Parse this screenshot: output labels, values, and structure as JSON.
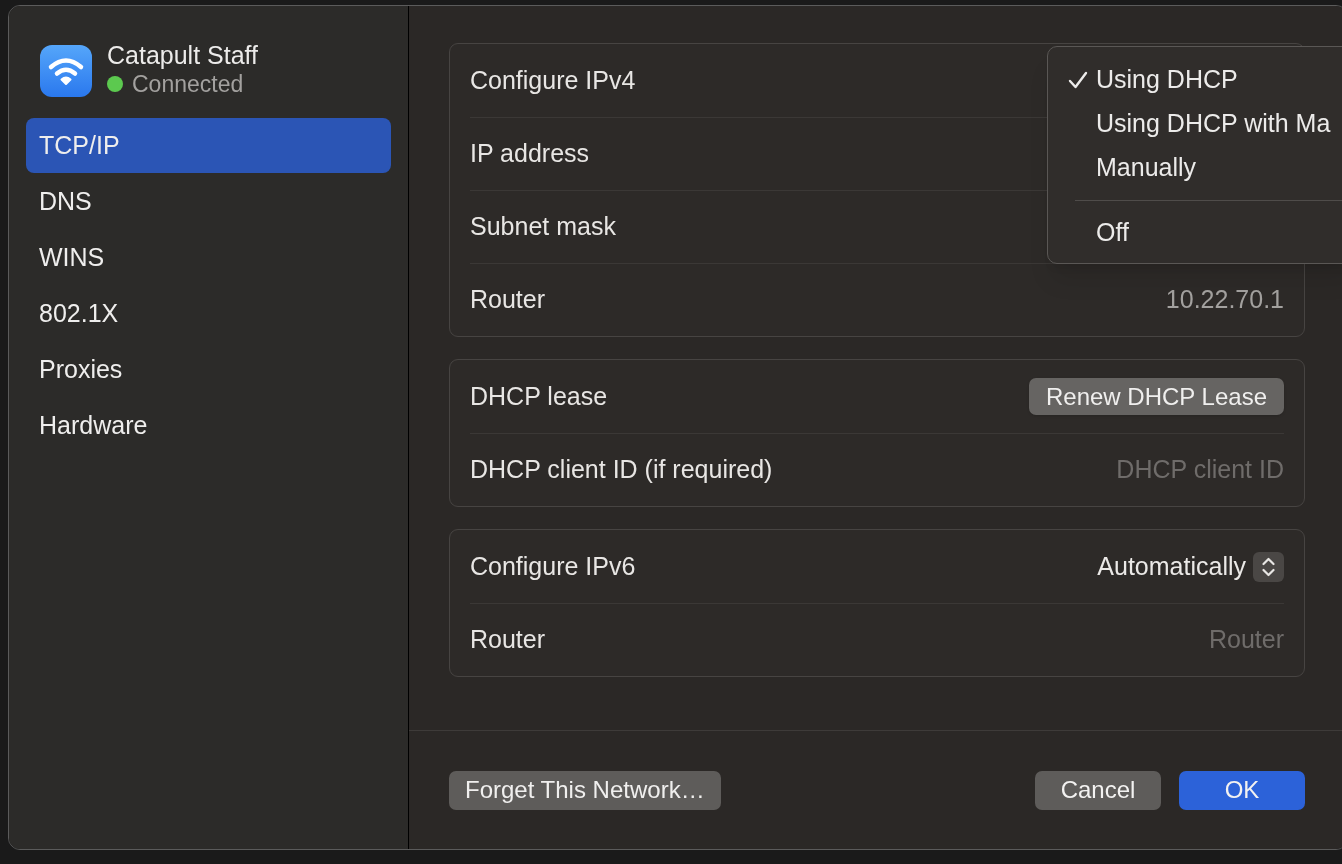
{
  "sidebar": {
    "network": {
      "name": "Catapult Staff",
      "status": "Connected",
      "connected": true
    },
    "items": [
      {
        "label": "TCP/IP",
        "selected": true
      },
      {
        "label": "DNS",
        "selected": false
      },
      {
        "label": "WINS",
        "selected": false
      },
      {
        "label": "802.1X",
        "selected": false
      },
      {
        "label": "Proxies",
        "selected": false
      },
      {
        "label": "Hardware",
        "selected": false
      }
    ]
  },
  "groups": [
    {
      "rows": [
        {
          "kind": "select",
          "label": "Configure IPv4"
        },
        {
          "kind": "value",
          "label": "IP address"
        },
        {
          "kind": "value",
          "label": "Subnet mask"
        },
        {
          "kind": "value",
          "label": "Router",
          "value": "10.22.70.1"
        }
      ]
    },
    {
      "rows": [
        {
          "kind": "button",
          "label": "DHCP lease",
          "button": "Renew DHCP Lease"
        },
        {
          "kind": "field",
          "label": "DHCP client ID (if required)",
          "placeholder": "DHCP client ID"
        }
      ]
    },
    {
      "rows": [
        {
          "kind": "select",
          "label": "Configure IPv6",
          "value": "Automatically"
        },
        {
          "kind": "field",
          "label": "Router",
          "placeholder": "Router"
        }
      ]
    }
  ],
  "menu": {
    "items": [
      {
        "kind": "option",
        "label": "Using DHCP",
        "selected": true
      },
      {
        "kind": "option",
        "label": "Using DHCP with Ma",
        "selected": false
      },
      {
        "kind": "option",
        "label": "Manually",
        "selected": false
      },
      {
        "kind": "separator"
      },
      {
        "kind": "option",
        "label": "Off",
        "selected": false
      }
    ]
  },
  "footer": {
    "left_buttons": [
      {
        "label": "Forget This Network…",
        "primary": false
      }
    ],
    "right_buttons": [
      {
        "label": "Cancel",
        "primary": false
      },
      {
        "label": "OK",
        "primary": true
      }
    ]
  }
}
